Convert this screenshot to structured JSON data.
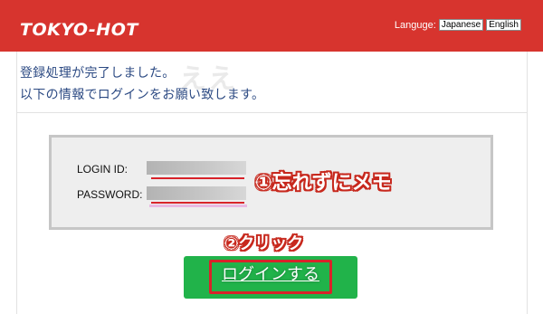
{
  "header": {
    "logo": "TOKYO-HOT",
    "language_label": "Languge:",
    "languages": [
      "Japanese",
      "English"
    ]
  },
  "messages": [
    "登録処理が完了しました。",
    "以下の情報でログインをお願い致します。"
  ],
  "credentials": {
    "login_label": "LOGIN ID:",
    "password_label": "PASSWORD:"
  },
  "annotations": {
    "memo_note": "①忘れずにメモ",
    "click_note": "②クリック"
  },
  "login_button": {
    "label": "ログインする"
  },
  "colors": {
    "header_bg": "#d7342e",
    "message_text": "#2c4a83",
    "button_bg": "#21b34a",
    "annotation_red": "#d8232a"
  }
}
